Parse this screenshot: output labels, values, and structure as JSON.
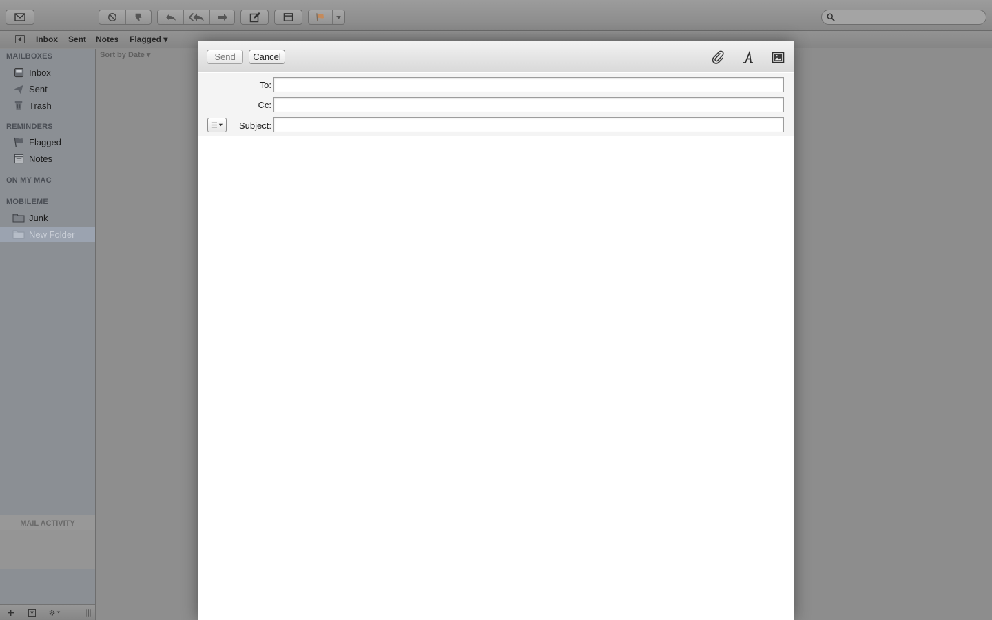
{
  "favorites_bar": {
    "items": [
      "Inbox",
      "Sent",
      "Notes",
      "Flagged ▾"
    ]
  },
  "search": {
    "placeholder": ""
  },
  "sidebar": {
    "sections": {
      "mailboxes": "MAILBOXES",
      "reminders": "REMINDERS",
      "on_my_mac": "ON MY MAC",
      "mobileme": "MOBILEME"
    },
    "items": {
      "inbox": {
        "label": "Inbox",
        "icon": "inbox-tray-icon"
      },
      "sent": {
        "label": "Sent",
        "icon": "paper-plane-icon"
      },
      "trash": {
        "label": "Trash",
        "icon": "trash-can-icon"
      },
      "flagged": {
        "label": "Flagged",
        "icon": "flag-icon"
      },
      "notes": {
        "label": "Notes",
        "icon": "notepad-icon"
      },
      "junk": {
        "label": "Junk",
        "icon": "folder-icon"
      },
      "new_folder": {
        "label": "New Folder",
        "icon": "folder-icon",
        "selected": true
      }
    },
    "activity_title": "MAIL ACTIVITY"
  },
  "message_list": {
    "sort_label": "Sort by Date ▾"
  },
  "compose": {
    "send_label": "Send",
    "cancel_label": "Cancel",
    "to_label": "To:",
    "cc_label": "Cc:",
    "subject_label": "Subject:",
    "to_value": "",
    "cc_value": "",
    "subject_value": "",
    "tools": [
      "paperclip-icon",
      "fonts-icon",
      "photo-browser-icon"
    ]
  },
  "colors": {
    "dim_background": "#8d8d8d",
    "sidebar_selected": "#9ba3b0",
    "compose_toolbar_top": "#f2f2f2",
    "compose_toolbar_bottom": "#d9d9d9"
  }
}
